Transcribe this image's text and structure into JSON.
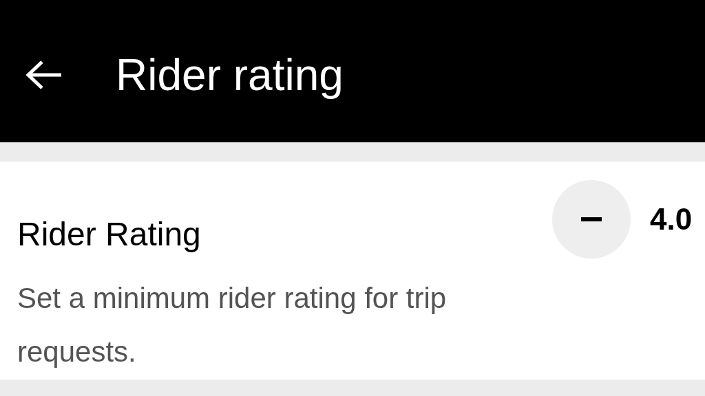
{
  "header": {
    "title": "Rider rating"
  },
  "setting": {
    "title": "Rider Rating",
    "description": "Set a minimum rider rating for trip requests.",
    "value": "4.0"
  }
}
